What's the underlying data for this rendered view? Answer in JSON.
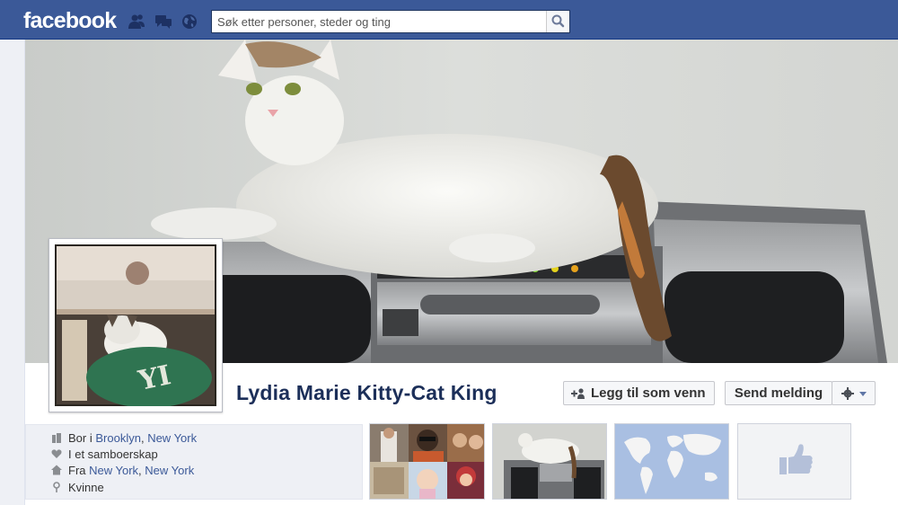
{
  "app": {
    "logo_text": "facebook"
  },
  "topbar": {
    "jewels": [
      "friend-requests-icon",
      "messages-icon",
      "notifications-globe-icon"
    ],
    "search": {
      "placeholder": "Søk etter personer, steder og ting",
      "value": ""
    }
  },
  "profile": {
    "name": "Lydia Marie Kitty-Cat King",
    "actions": {
      "add_friend": "Legg til som venn",
      "send_message": "Send melding"
    },
    "info": {
      "lives_prefix": "Bor i",
      "lives_city": "Brooklyn",
      "lives_sep": ",",
      "lives_state": "New York",
      "relationship": "I et samboerskap",
      "from_prefix": "Fra",
      "from_city": "New York",
      "from_sep": ",",
      "from_state": "New York",
      "gender": "Kvinne"
    }
  },
  "colors": {
    "brand": "#3b5998",
    "name": "#1c2f59",
    "link": "#3b5998"
  }
}
